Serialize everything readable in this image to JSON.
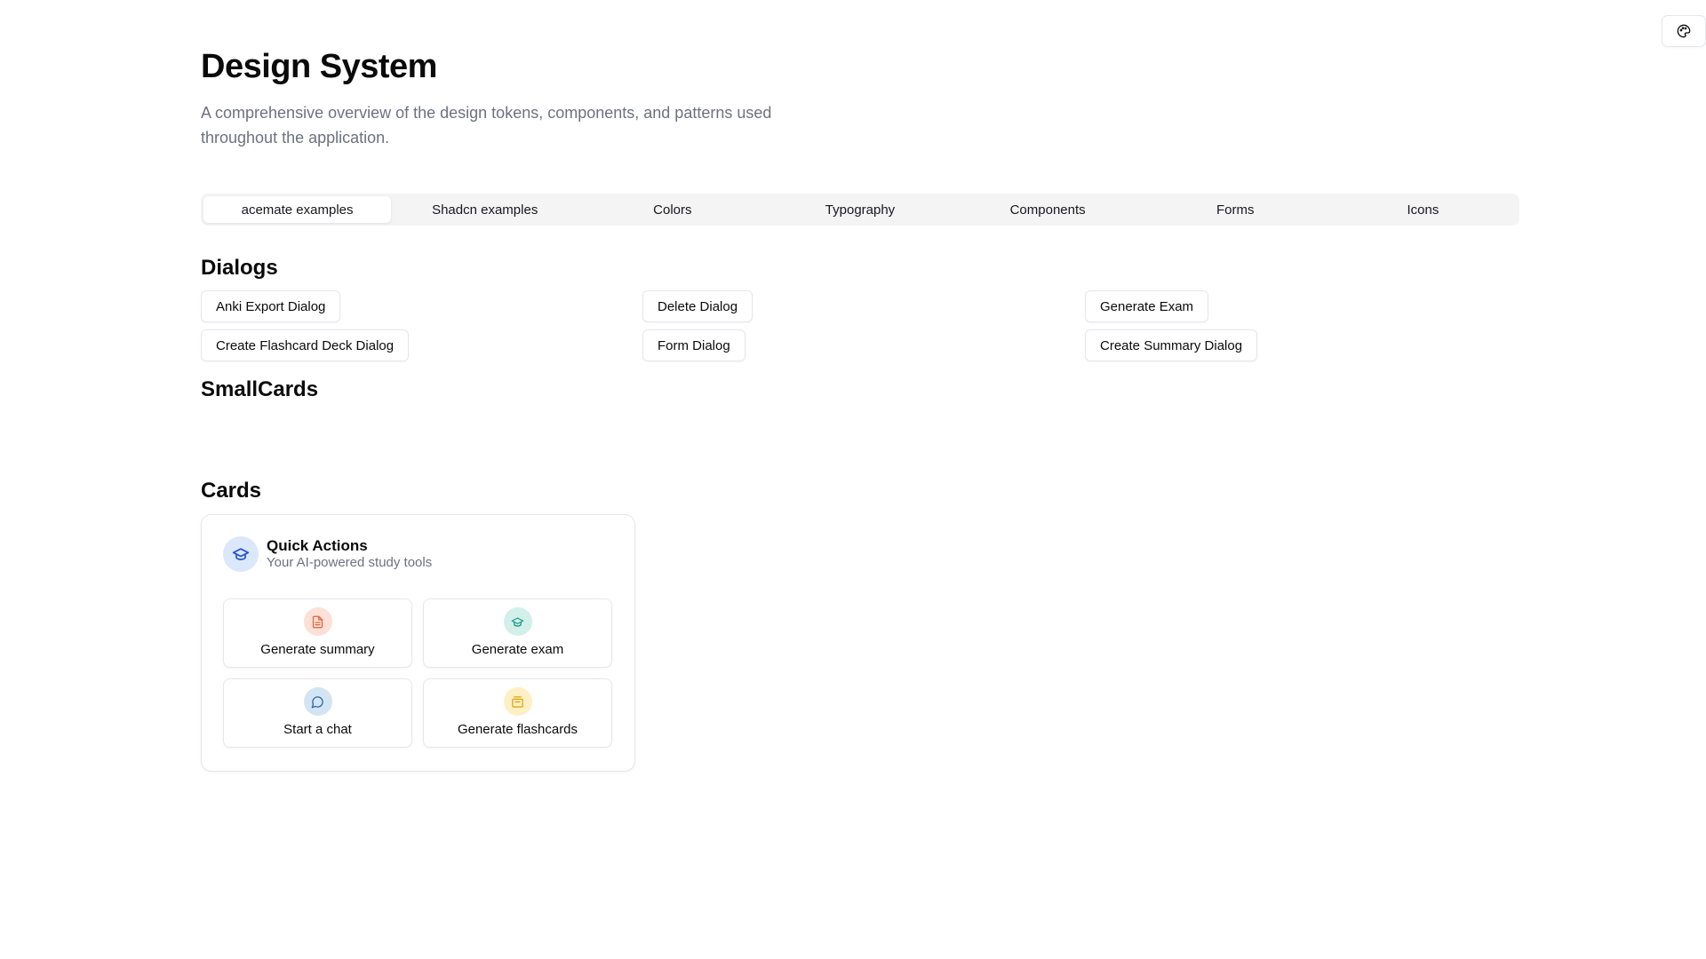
{
  "page": {
    "title": "Design System",
    "description": "A comprehensive overview of the design tokens, components, and patterns used throughout the application."
  },
  "theme_toggle": {
    "icon": "palette-icon"
  },
  "tabs": [
    {
      "label": "acemate examples",
      "active": true
    },
    {
      "label": "Shadcn examples",
      "active": false
    },
    {
      "label": "Colors",
      "active": false
    },
    {
      "label": "Typography",
      "active": false
    },
    {
      "label": "Components",
      "active": false
    },
    {
      "label": "Forms",
      "active": false
    },
    {
      "label": "Icons",
      "active": false
    }
  ],
  "sections": {
    "dialogs": {
      "heading": "Dialogs",
      "buttons": [
        "Anki Export Dialog",
        "Delete Dialog",
        "Generate Exam",
        "Create Flashcard Deck Dialog",
        "Form Dialog",
        "Create Summary Dialog"
      ]
    },
    "small_cards": {
      "heading": "SmallCards"
    },
    "cards": {
      "heading": "Cards"
    }
  },
  "quick_actions_card": {
    "title": "Quick Actions",
    "subtitle": "Your AI-powered study tools",
    "header_icon": "graduation-cap-icon",
    "header_icon_color": "#1d4ed8",
    "actions": [
      {
        "label": "Generate summary",
        "icon": "file-text-icon",
        "bg": "#fde0d6",
        "color": "#e0633a"
      },
      {
        "label": "Generate exam",
        "icon": "graduation-cap-icon",
        "bg": "#d3efe9",
        "color": "#179a85"
      },
      {
        "label": "Start a chat",
        "icon": "message-circle-icon",
        "bg": "#d3e4f3",
        "color": "#2563a6"
      },
      {
        "label": "Generate flashcards",
        "icon": "layers-icon",
        "bg": "#fdf0c4",
        "color": "#e3a008"
      }
    ]
  }
}
